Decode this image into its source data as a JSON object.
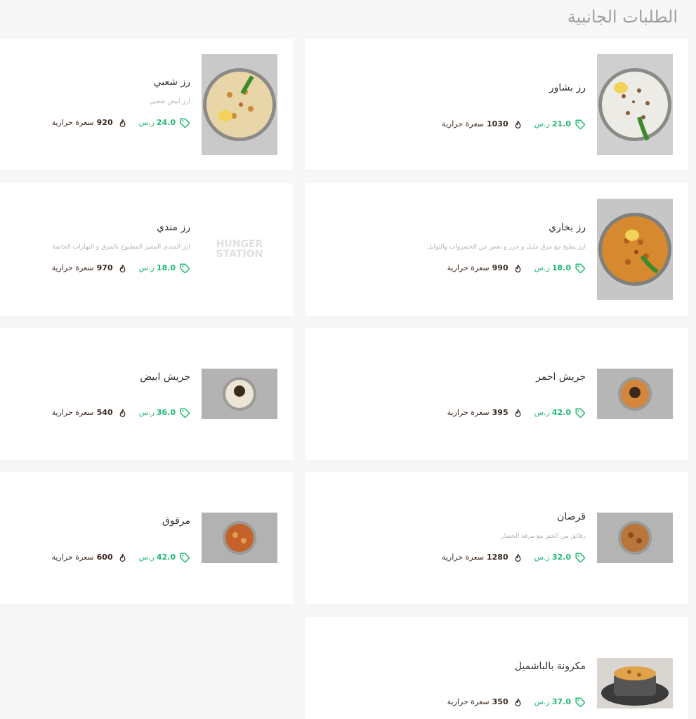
{
  "section": {
    "title": "الطلبات الجانبية"
  },
  "colors": {
    "price": "#1db872",
    "calories": "#3a2a20",
    "title": "#9e9e9e"
  },
  "placeholder": {
    "line1": "HUNGER",
    "line2": "STATION"
  },
  "items": [
    {
      "name": "رز بشاور",
      "desc": "",
      "price": "21.0",
      "currency": "ر.س",
      "calories": "1030",
      "cal_label": "سعرة حرارية",
      "image": "white-rice-bowl"
    },
    {
      "name": "رز شعبي",
      "desc": "ارز ابيض شعبي",
      "price": "24.0",
      "currency": "ر.س",
      "calories": "920",
      "cal_label": "سعرة حرارية",
      "image": "yellow-rice-bowl"
    },
    {
      "name": "رز بخاري",
      "desc": "ارز يطبخ مع مرق مليل و جزر و بعض من الخضروات والتوابل",
      "price": "18.0",
      "currency": "ر.س",
      "calories": "990",
      "cal_label": "سعرة حرارية",
      "image": "bukhari-rice-bowl"
    },
    {
      "name": "رز مندي",
      "desc": "ارز المندي المميز المطبوخ بالمرق و البهارات الخاصة",
      "price": "18.0",
      "currency": "ر.س",
      "calories": "970",
      "cal_label": "سعرة حرارية",
      "image": "placeholder-logo"
    },
    {
      "name": "جريش احمر",
      "desc": "",
      "price": "42.0",
      "currency": "ر.س",
      "calories": "395",
      "cal_label": "سعرة حرارية",
      "image": "red-jareesh-bowl"
    },
    {
      "name": "جريش ابيض",
      "desc": "",
      "price": "36.0",
      "currency": "ر.س",
      "calories": "540",
      "cal_label": "سعرة حرارية",
      "image": "white-jareesh-bowl"
    },
    {
      "name": "قرصان",
      "desc": "رقائق من الخبز مع مرقة الخضار",
      "price": "32.0",
      "currency": "ر.س",
      "calories": "1280",
      "cal_label": "سعرة حرارية",
      "image": "qursan-bowl"
    },
    {
      "name": "مرقوق",
      "desc": "",
      "price": "42.0",
      "currency": "ر.س",
      "calories": "600",
      "cal_label": "سعرة حرارية",
      "image": "marqooq-bowl"
    },
    {
      "name": "مكرونة بالباشميل",
      "desc": "",
      "price": "37.0",
      "currency": "ر.س",
      "calories": "350",
      "cal_label": "سعرة حرارية",
      "image": "bechamel-pasta-dish"
    }
  ]
}
